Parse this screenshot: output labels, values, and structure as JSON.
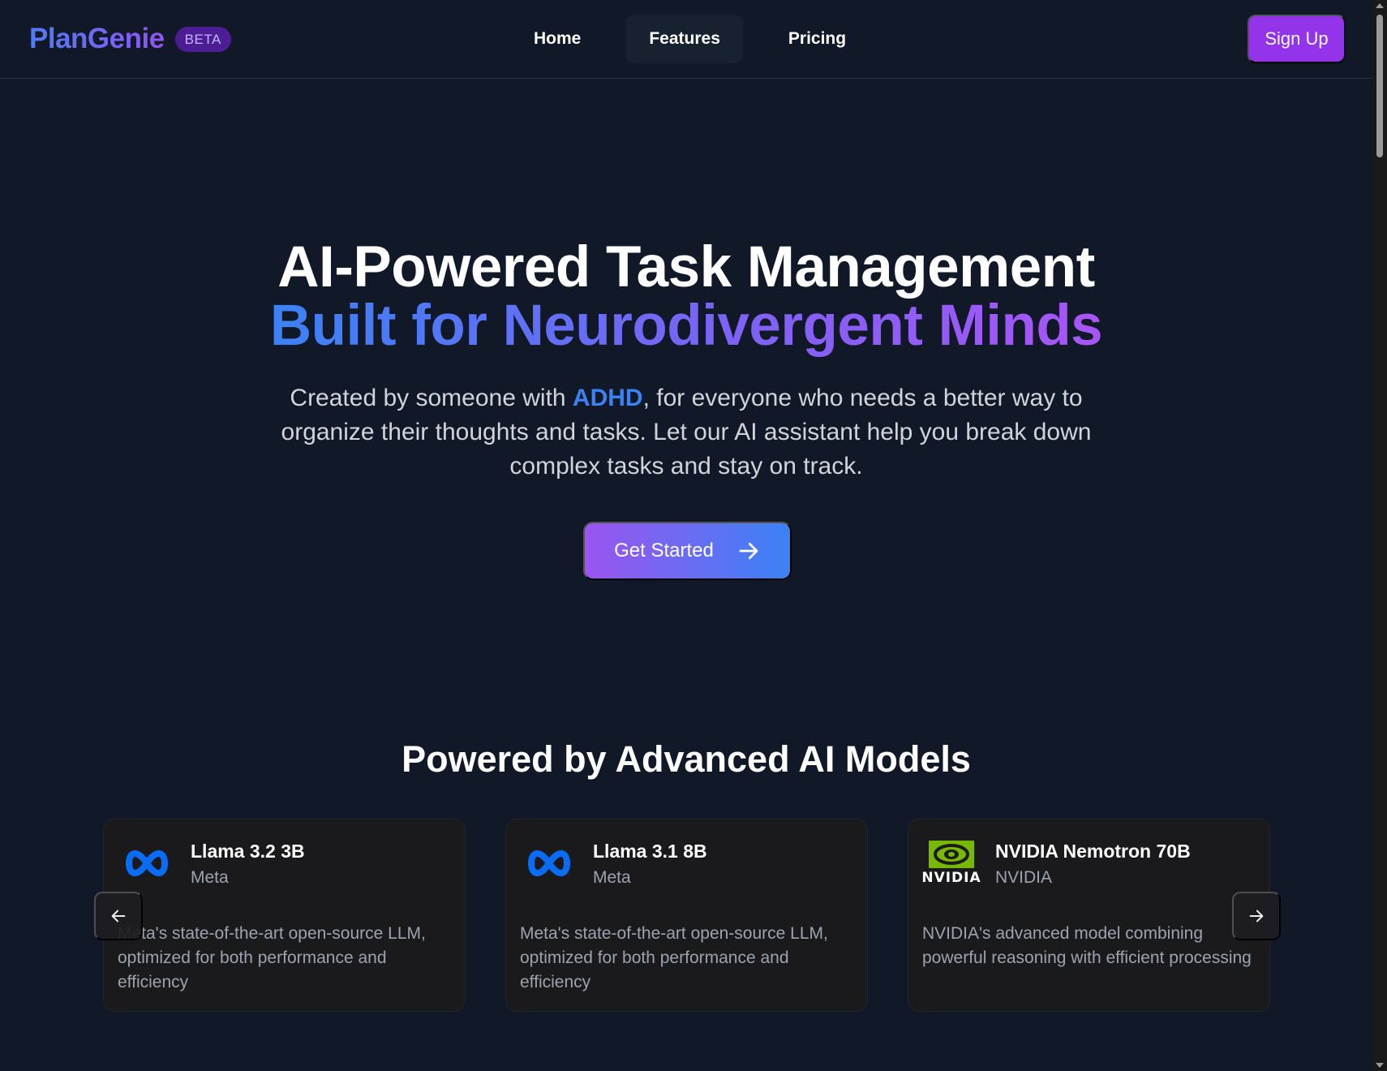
{
  "header": {
    "logo": "PlanGenie",
    "badge": "BETA",
    "nav": [
      {
        "label": "Home"
      },
      {
        "label": "Features"
      },
      {
        "label": "Pricing"
      }
    ],
    "signup_label": "Sign Up"
  },
  "hero": {
    "title_line1": "AI-Powered Task Management",
    "title_line2": "Built for Neurodivergent Minds",
    "desc_before": "Created by someone with ",
    "desc_highlight": "ADHD",
    "desc_after": ", for everyone who needs a better way to organize their thoughts and tasks. Let our AI assistant help you break down complex tasks and stay on track.",
    "cta_label": "Get Started"
  },
  "models": {
    "title": "Powered by Advanced AI Models",
    "cards": [
      {
        "name": "Llama 3.2 3B",
        "maker": "Meta",
        "icon": "meta-logo-icon",
        "description": "Meta's state-of-the-art open-source LLM, optimized for both performance and efficiency"
      },
      {
        "name": "Llama 3.1 8B",
        "maker": "Meta",
        "icon": "meta-logo-icon",
        "description": "Meta's state-of-the-art open-source LLM, optimized for both performance and efficiency"
      },
      {
        "name": "NVIDIA Nemotron 70B",
        "maker": "NVIDIA",
        "icon": "nvidia-logo-icon",
        "logo_text": "NVIDIA",
        "description": "NVIDIA's advanced model combining powerful reasoning with efficient processing"
      }
    ],
    "prev_icon": "arrow-left-icon",
    "next_icon": "arrow-right-icon"
  },
  "colors": {
    "background": "#111827",
    "accent_purple": "#9333ea",
    "accent_blue": "#3b82f6",
    "card_bg": "#1a1a1c"
  }
}
